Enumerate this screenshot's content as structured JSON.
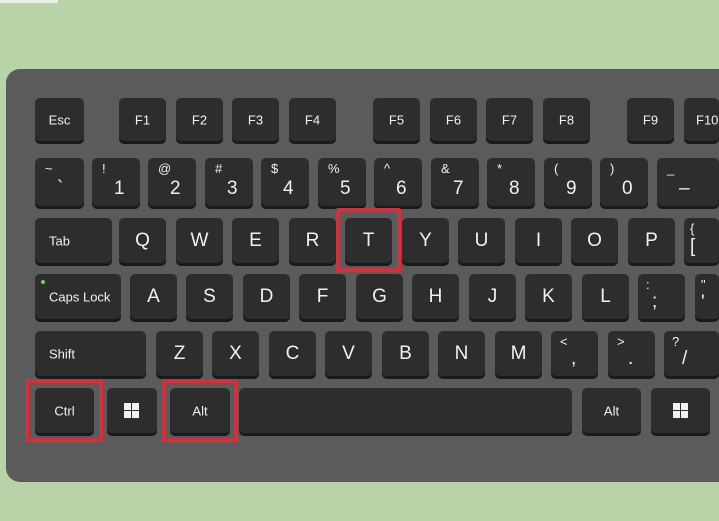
{
  "keyboard": {
    "function_row": {
      "esc": "Esc",
      "f1": "F1",
      "f2": "F2",
      "f3": "F3",
      "f4": "F4",
      "f5": "F5",
      "f6": "F6",
      "f7": "F7",
      "f8": "F8",
      "f9": "F9",
      "f10": "F10"
    },
    "number_row": [
      {
        "id": "tilde",
        "upper": "~",
        "lower": "`"
      },
      {
        "id": "1",
        "upper": "!",
        "lower": "1"
      },
      {
        "id": "2",
        "upper": "@",
        "lower": "2"
      },
      {
        "id": "3",
        "upper": "#",
        "lower": "3"
      },
      {
        "id": "4",
        "upper": "$",
        "lower": "4"
      },
      {
        "id": "5",
        "upper": "%",
        "lower": "5"
      },
      {
        "id": "6",
        "upper": "^",
        "lower": "6"
      },
      {
        "id": "7",
        "upper": "&",
        "lower": "7"
      },
      {
        "id": "8",
        "upper": "*",
        "lower": "8"
      },
      {
        "id": "9",
        "upper": "(",
        "lower": "9"
      },
      {
        "id": "0",
        "upper": ")",
        "lower": "0"
      },
      {
        "id": "minus",
        "upper": "_",
        "lower": "–"
      }
    ],
    "qwerty_row": {
      "tab": "Tab",
      "letters": [
        "Q",
        "W",
        "E",
        "R",
        "T",
        "Y",
        "U",
        "I",
        "O",
        "P"
      ],
      "bracket_upper": "{",
      "bracket_lower": "["
    },
    "home_row": {
      "caps": "Caps Lock",
      "letters": [
        "A",
        "S",
        "D",
        "F",
        "G",
        "H",
        "J",
        "K",
        "L"
      ],
      "semicolon_upper": ":",
      "semicolon_lower": ";",
      "quote_upper": "\"",
      "quote_lower": "'"
    },
    "bottom_letter_row": {
      "shift": "Shift",
      "letters": [
        "Z",
        "X",
        "C",
        "V",
        "B",
        "N",
        "M"
      ],
      "comma_upper": "<",
      "comma_lower": ",",
      "period_upper": ">",
      "period_lower": ".",
      "slash_upper": "?",
      "slash_lower": "/"
    },
    "space_row": {
      "ctrl": "Ctrl",
      "alt_left": "Alt",
      "alt_right": "Alt"
    }
  },
  "highlight_color": "#d42f3d",
  "highlighted_keys": [
    "Ctrl",
    "Alt",
    "T"
  ],
  "icons": {
    "windows": "windows-logo-icon"
  }
}
